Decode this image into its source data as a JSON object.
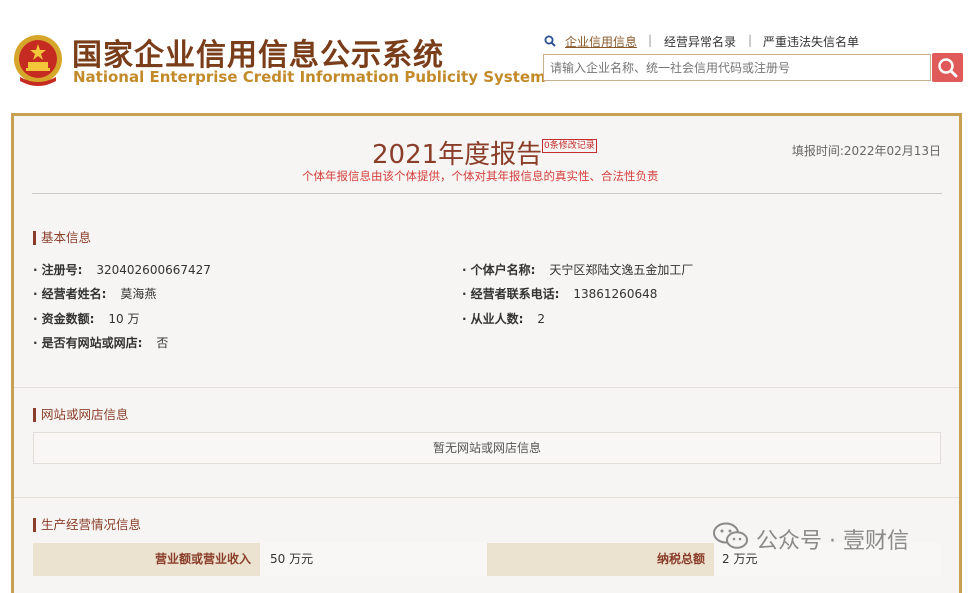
{
  "header": {
    "title_cn": "国家企业信用信息公示系统",
    "title_en": "National Enterprise Credit Information Publicity System",
    "nav": [
      "企业信用信息",
      "经营异常名录",
      "严重违法失信名单"
    ],
    "search_placeholder": "请输入企业名称、统一社会信用代码或注册号",
    "accent": "#e05a5a"
  },
  "report": {
    "title": "2021年度报告",
    "mod_badge": "0条修改记录",
    "fill_time": "填报时间:2022年02月13日",
    "notice": "个体年报信息由该个体提供，个体对其年报信息的真实性、合法性负责"
  },
  "basic": {
    "section_title": "基本信息",
    "fields": [
      {
        "label": "注册号:",
        "value": "320402600667427"
      },
      {
        "label": "个体户名称:",
        "value": "天宁区郑陆文逸五金加工厂"
      },
      {
        "label": "经营者姓名:",
        "value": "莫海燕"
      },
      {
        "label": "经营者联系电话:",
        "value": "13861260648"
      },
      {
        "label": "资金数额:",
        "value": "10 万"
      },
      {
        "label": "从业人数:",
        "value": "2"
      },
      {
        "label": "是否有网站或网店:",
        "value": "否"
      }
    ]
  },
  "website": {
    "section_title": "网站或网店信息",
    "empty_text": "暂无网站或网店信息"
  },
  "production": {
    "section_title": "生产经营情况信息",
    "rows": [
      {
        "label1": "营业额或营业收入",
        "value1": "50 万元",
        "label2": "纳税总额",
        "value2": "2 万元"
      }
    ]
  },
  "watermark": {
    "text": "公众号 · 壹财信"
  }
}
